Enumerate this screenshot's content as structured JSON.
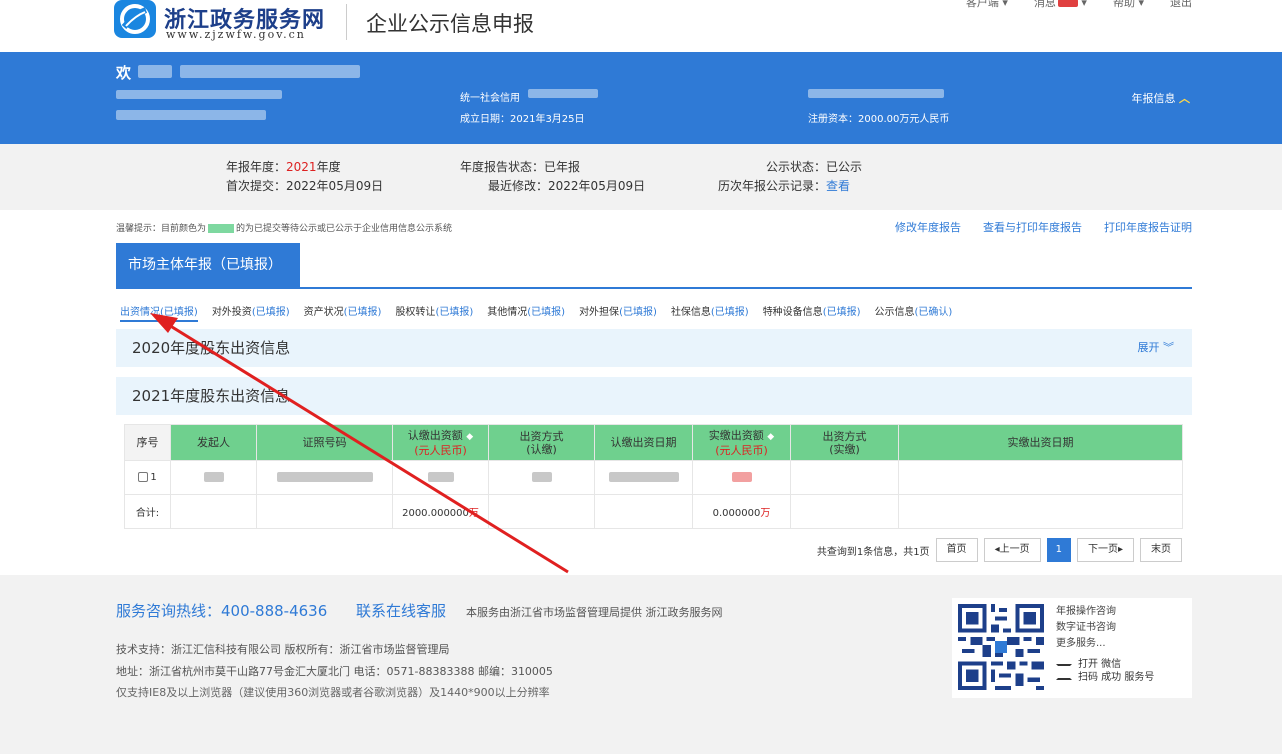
{
  "header": {
    "logo_title": "浙江政务服务网",
    "logo_url_text": "www.zjzwfw.gov.cn",
    "page_title": "企业公示信息申报",
    "top_links": [
      "客户端",
      "消息",
      "帮助",
      "退出"
    ]
  },
  "banner": {
    "welcome": "欢",
    "credit_code_label": "统一社会信用",
    "established_label": "成立日期：2021年3月25日",
    "capital_label": "注册资本：2000.00万元人民币",
    "annual_toggle": "年报信息"
  },
  "status": {
    "year_label": "年报年度：",
    "year_value": "2021",
    "year_suffix": "年度",
    "first_submit_label": "首次提交：",
    "first_submit_value": "2022年05月09日",
    "report_status_label": "年度报告状态：",
    "report_status_value": "已年报",
    "last_modified_label": "最近修改：",
    "last_modified_value": "2022年05月09日",
    "publish_status_label": "公示状态：",
    "publish_status_value": "已公示",
    "history_label": "历次年报公示记录：",
    "history_link": "查看"
  },
  "notice": {
    "text_before": "温馨提示：目前颜色为",
    "text_after": "的为已提交等待公示或已公示于企业信用信息公示系统"
  },
  "actions": [
    "修改年度报告",
    "查看与打印年度报告",
    "打印年度报告证明"
  ],
  "main_tab": "市场主体年报（已填报）",
  "subtabs": [
    {
      "name": "出资情况",
      "state": "(已填报)"
    },
    {
      "name": "对外投资",
      "state": "(已填报)"
    },
    {
      "name": "资产状况",
      "state": "(已填报)"
    },
    {
      "name": "股权转让",
      "state": "(已填报)"
    },
    {
      "name": "其他情况",
      "state": "(已填报)"
    },
    {
      "name": "对外担保",
      "state": "(已填报)"
    },
    {
      "name": "社保信息",
      "state": "(已填报)"
    },
    {
      "name": "特种设备信息",
      "state": "(已填报)"
    },
    {
      "name": "公示信息",
      "state": "(已确认)"
    }
  ],
  "sections": {
    "s2020": "2020年度股东出资信息",
    "s2020_expand": "展开",
    "s2021": "2021年度股东出资信息"
  },
  "table": {
    "headers": {
      "seq": "序号",
      "promoter": "发起人",
      "id_no": "证照号码",
      "subscribed": "认缴出资额",
      "subscribed_unit": "(元人民币)",
      "sub_method": "出资方式",
      "sub_method_sub": "(认缴)",
      "sub_date": "认缴出资日期",
      "paid": "实缴出资额",
      "paid_unit": "(元人民币)",
      "paid_method": "出资方式",
      "paid_method_sub": "(实缴)",
      "paid_date": "实缴出资日期"
    },
    "row1_seq": "1",
    "total_label": "合计:",
    "total_subscribed": "2000.000000",
    "total_paid": "0.000000",
    "unit_wan": "万"
  },
  "pager": {
    "summary": "共查询到1条信息，共1页",
    "first": "首页",
    "prev": "上一页",
    "current": "1",
    "next": "下一页",
    "last": "末页"
  },
  "footer": {
    "hotline": "服务咨询热线：400-888-4636",
    "online": "联系在线客服",
    "provider": "本服务由浙江省市场监督管理局提供    浙江政务服务网",
    "tech_support": "技术支持：浙江汇信科技有限公司      版权所有：浙江省市场监督管理局",
    "address": "地址：浙江省杭州市莫干山路77号金汇大厦北门  电话：0571-88383388  邮编：310005",
    "browser_note": "仅支持IE8及以上浏览器（建议使用360浏览器或者谷歌浏览器）及1440*900以上分辨率",
    "qr_lines": [
      "年报操作咨询",
      "数字证书咨询",
      "更多服务..."
    ],
    "scan_line1": "打开  微信",
    "scan_line2": "扫码  成功  服务号"
  },
  "colors": {
    "primary_blue": "#2f7ad6",
    "header_green": "#6fd08e",
    "accent_red": "#dd2222"
  }
}
